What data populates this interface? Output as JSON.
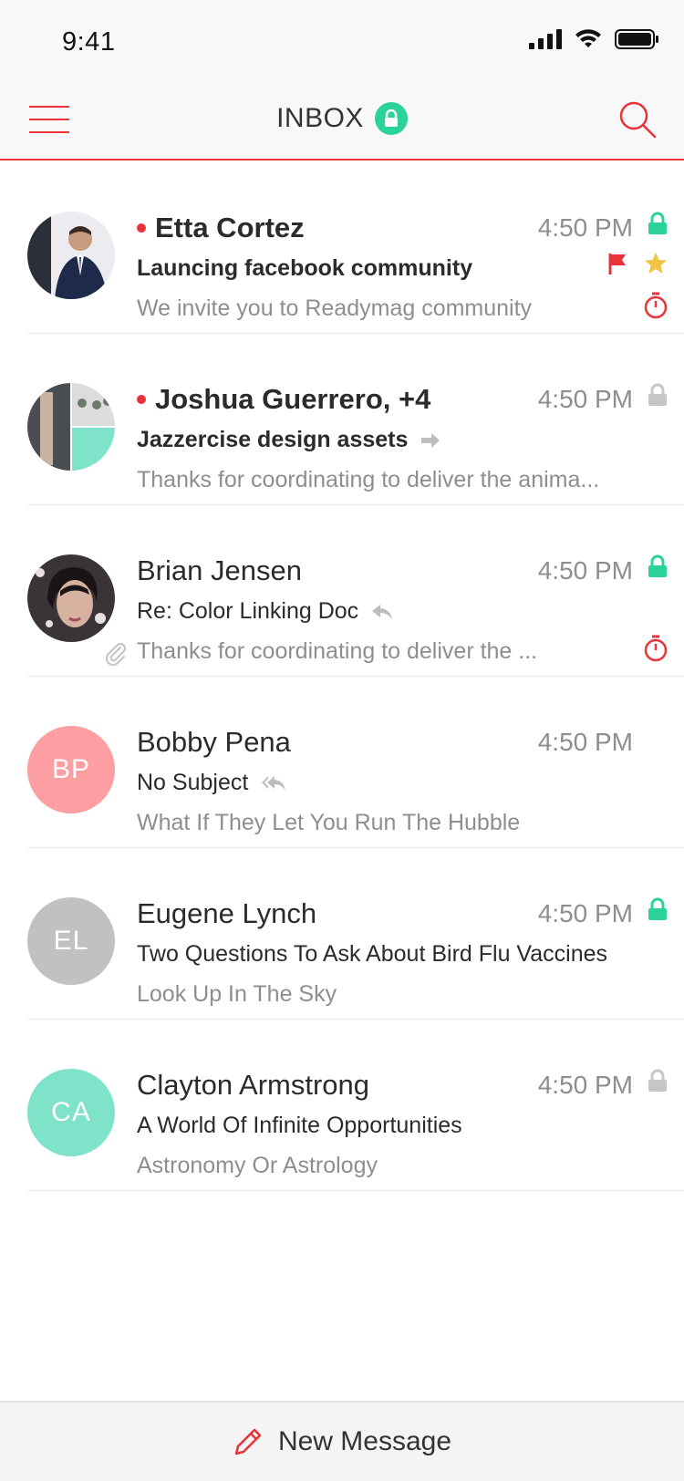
{
  "status_bar": {
    "time": "9:41"
  },
  "nav": {
    "title": "INBOX"
  },
  "colors": {
    "accent": "#e8333b",
    "green": "#2bd29a",
    "star": "#f5c342",
    "grey_icon": "#c6c6c6"
  },
  "emails": [
    {
      "sender": "Etta Cortez",
      "unread": true,
      "time": "4:50 PM",
      "subject": "Launcing facebook community",
      "preview": "We invite you to Readymag community",
      "avatar_type": "photo",
      "lock": "green",
      "flag": true,
      "star": true,
      "timer": true
    },
    {
      "sender": "Joshua Guerrero, +4",
      "unread": true,
      "time": "4:50 PM",
      "subject": "Jazzercise design assets",
      "preview": "Thanks for coordinating to deliver the anima...",
      "avatar_type": "group",
      "lock": "grey",
      "subject_icon": "forward-icon"
    },
    {
      "sender": "Brian Jensen",
      "unread": false,
      "time": "4:50 PM",
      "subject": "Re: Color Linking Doc",
      "preview": "Thanks for coordinating to deliver the ...",
      "avatar_type": "photo",
      "lock": "green",
      "subject_icon": "reply-icon",
      "attachment": true,
      "timer": true
    },
    {
      "sender": "Bobby Pena",
      "unread": false,
      "time": "4:50 PM",
      "subject": "No Subject",
      "preview": "What If They Let You Run The Hubble",
      "avatar_type": "initials",
      "initials": "BP",
      "avatar_color": "#fd9ea2",
      "subject_icon": "reply-all-icon"
    },
    {
      "sender": "Eugene Lynch",
      "unread": false,
      "time": "4:50 PM",
      "subject": "Two Questions To Ask About Bird Flu Vaccines",
      "preview": "Look Up In The Sky",
      "avatar_type": "initials",
      "initials": "EL",
      "avatar_color": "#c2c0c1",
      "lock": "green"
    },
    {
      "sender": "Clayton Armstrong",
      "unread": false,
      "time": "4:50 PM",
      "subject": "A World Of Infinite Opportunities",
      "preview": "Astronomy Or Astrology",
      "avatar_type": "initials",
      "initials": "CA",
      "avatar_color": "#7fe3c9",
      "lock": "grey"
    }
  ],
  "bottom": {
    "new_message_label": "New Message"
  }
}
